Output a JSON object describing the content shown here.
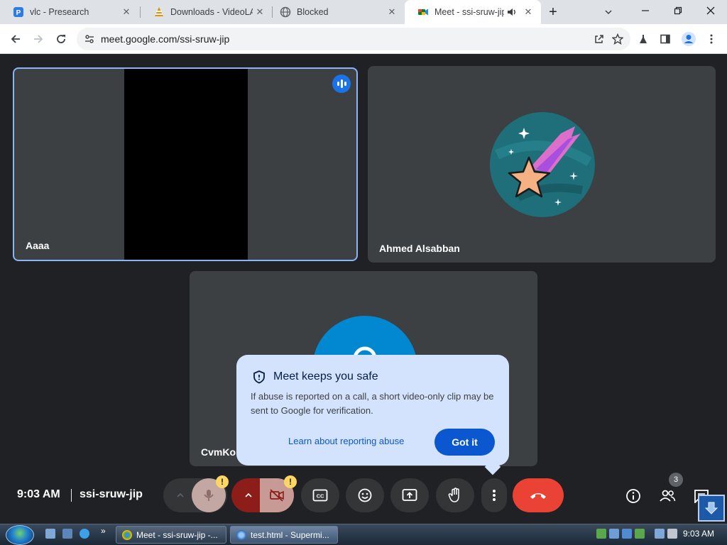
{
  "browser": {
    "tabs": [
      {
        "title": "vlc - Presearch",
        "close": "✕"
      },
      {
        "title": "Downloads - VideoLA",
        "close": "✕"
      },
      {
        "title": "Blocked",
        "close": "✕"
      },
      {
        "title": "Meet - ssi-sruw-jip",
        "close": "✕"
      }
    ],
    "new_tab": "+",
    "url": "meet.google.com/ssi-sruw-jip"
  },
  "meet": {
    "tiles": [
      {
        "name": "Aaaa"
      },
      {
        "name": "Ahmed Alsabban"
      },
      {
        "name": "CvmKo"
      }
    ],
    "tooltip": {
      "title": "Meet keeps you safe",
      "body": "If abuse is reported on a call, a short video-only clip may be sent to Google for verification.",
      "link": "Learn about reporting abuse",
      "button": "Got it"
    },
    "meeting_time": "9:03 AM",
    "meeting_code": "ssi-sruw-jip",
    "warning_mark": "!",
    "people_count": "3"
  },
  "taskbar": {
    "items": [
      "Meet - ssi-sruw-jip -...",
      "test.html - Supermi..."
    ],
    "clock": "9:03 AM",
    "more": "»"
  },
  "colors": {
    "meet_bg": "#202124",
    "tile_bg": "#3c4043",
    "active_speaker": "#8ab4f8",
    "hangup": "#ea4335",
    "cam_off": "#8c1d18",
    "tooltip_bg": "#d3e3fd",
    "primary_button": "#0b57d0"
  }
}
